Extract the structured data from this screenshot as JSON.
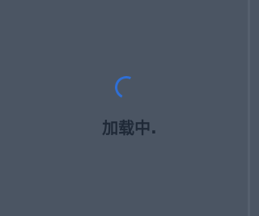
{
  "loading": {
    "text": "加载中."
  },
  "colors": {
    "background": "#4b5563",
    "spinner_accent": "#2f6fd6",
    "text": "#1f2937"
  },
  "icons": {
    "spinner": "loading-spinner-icon"
  }
}
